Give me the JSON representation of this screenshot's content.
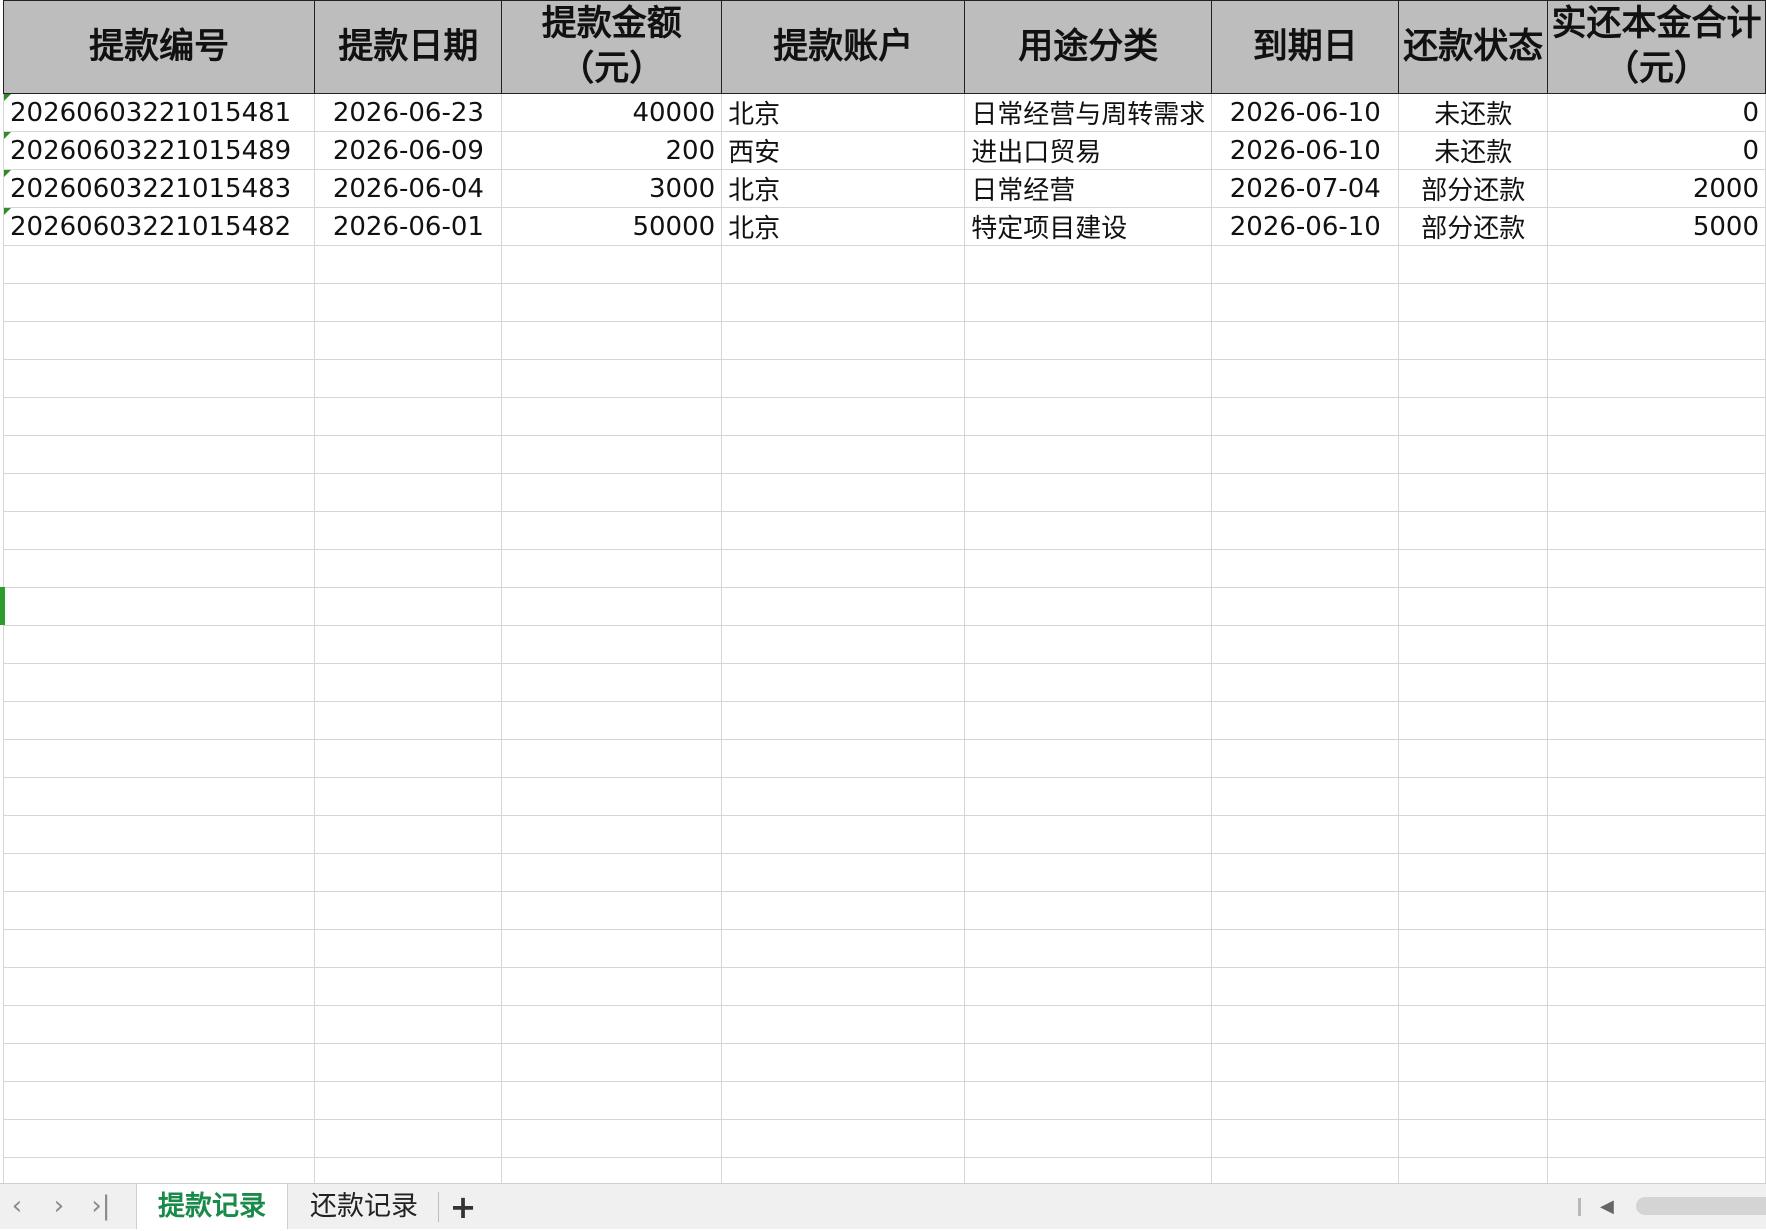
{
  "columns": [
    "提款编号",
    "提款日期",
    "提款金额\n（元）",
    "提款账户",
    "用途分类",
    "到期日",
    "还款状态",
    "实还本金合计\n（元）"
  ],
  "rows": [
    [
      "20260603221015481",
      "2026-06-23",
      "40000",
      "北京",
      "日常经营与周转需求",
      "2026-06-10",
      "未还款",
      "0"
    ],
    [
      "20260603221015489",
      "2026-06-09",
      "200",
      "西安",
      "进出口贸易",
      "2026-06-10",
      "未还款",
      "0"
    ],
    [
      "20260603221015483",
      "2026-06-04",
      "3000",
      "北京",
      "日常经营",
      "2026-07-04",
      "部分还款",
      "2000"
    ],
    [
      "20260603221015482",
      "2026-06-01",
      "50000",
      "北京",
      "特定项目建设",
      "2026-06-10",
      "部分还款",
      "5000"
    ]
  ],
  "empty_row_count": 25,
  "sheet_tabs": {
    "active": "提款记录",
    "other": "还款记录",
    "add_label": "+"
  },
  "nav_icons": [
    "prev-sheet-icon",
    "next-sheet-icon",
    "last-sheet-icon"
  ],
  "colors": {
    "header_bg": "#bdbdbd",
    "active_tab_text": "#1a8a4a",
    "cell_marker": "#2e8b2e"
  }
}
